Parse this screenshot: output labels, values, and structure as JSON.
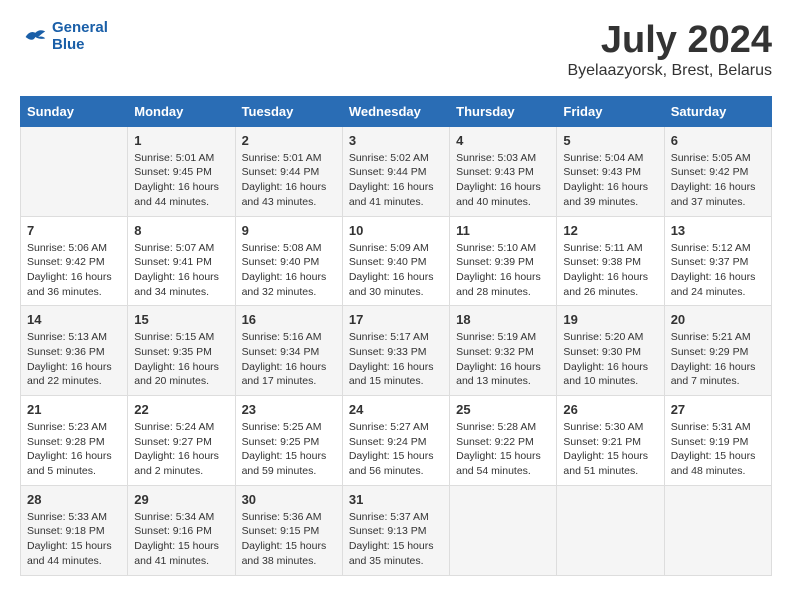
{
  "header": {
    "logo_line1": "General",
    "logo_line2": "Blue",
    "month_title": "July 2024",
    "location": "Byelaazyorsk, Brest, Belarus"
  },
  "weekdays": [
    "Sunday",
    "Monday",
    "Tuesday",
    "Wednesday",
    "Thursday",
    "Friday",
    "Saturday"
  ],
  "weeks": [
    [
      {
        "day": "",
        "info": ""
      },
      {
        "day": "1",
        "info": "Sunrise: 5:01 AM\nSunset: 9:45 PM\nDaylight: 16 hours\nand 44 minutes."
      },
      {
        "day": "2",
        "info": "Sunrise: 5:01 AM\nSunset: 9:44 PM\nDaylight: 16 hours\nand 43 minutes."
      },
      {
        "day": "3",
        "info": "Sunrise: 5:02 AM\nSunset: 9:44 PM\nDaylight: 16 hours\nand 41 minutes."
      },
      {
        "day": "4",
        "info": "Sunrise: 5:03 AM\nSunset: 9:43 PM\nDaylight: 16 hours\nand 40 minutes."
      },
      {
        "day": "5",
        "info": "Sunrise: 5:04 AM\nSunset: 9:43 PM\nDaylight: 16 hours\nand 39 minutes."
      },
      {
        "day": "6",
        "info": "Sunrise: 5:05 AM\nSunset: 9:42 PM\nDaylight: 16 hours\nand 37 minutes."
      }
    ],
    [
      {
        "day": "7",
        "info": "Sunrise: 5:06 AM\nSunset: 9:42 PM\nDaylight: 16 hours\nand 36 minutes."
      },
      {
        "day": "8",
        "info": "Sunrise: 5:07 AM\nSunset: 9:41 PM\nDaylight: 16 hours\nand 34 minutes."
      },
      {
        "day": "9",
        "info": "Sunrise: 5:08 AM\nSunset: 9:40 PM\nDaylight: 16 hours\nand 32 minutes."
      },
      {
        "day": "10",
        "info": "Sunrise: 5:09 AM\nSunset: 9:40 PM\nDaylight: 16 hours\nand 30 minutes."
      },
      {
        "day": "11",
        "info": "Sunrise: 5:10 AM\nSunset: 9:39 PM\nDaylight: 16 hours\nand 28 minutes."
      },
      {
        "day": "12",
        "info": "Sunrise: 5:11 AM\nSunset: 9:38 PM\nDaylight: 16 hours\nand 26 minutes."
      },
      {
        "day": "13",
        "info": "Sunrise: 5:12 AM\nSunset: 9:37 PM\nDaylight: 16 hours\nand 24 minutes."
      }
    ],
    [
      {
        "day": "14",
        "info": "Sunrise: 5:13 AM\nSunset: 9:36 PM\nDaylight: 16 hours\nand 22 minutes."
      },
      {
        "day": "15",
        "info": "Sunrise: 5:15 AM\nSunset: 9:35 PM\nDaylight: 16 hours\nand 20 minutes."
      },
      {
        "day": "16",
        "info": "Sunrise: 5:16 AM\nSunset: 9:34 PM\nDaylight: 16 hours\nand 17 minutes."
      },
      {
        "day": "17",
        "info": "Sunrise: 5:17 AM\nSunset: 9:33 PM\nDaylight: 16 hours\nand 15 minutes."
      },
      {
        "day": "18",
        "info": "Sunrise: 5:19 AM\nSunset: 9:32 PM\nDaylight: 16 hours\nand 13 minutes."
      },
      {
        "day": "19",
        "info": "Sunrise: 5:20 AM\nSunset: 9:30 PM\nDaylight: 16 hours\nand 10 minutes."
      },
      {
        "day": "20",
        "info": "Sunrise: 5:21 AM\nSunset: 9:29 PM\nDaylight: 16 hours\nand 7 minutes."
      }
    ],
    [
      {
        "day": "21",
        "info": "Sunrise: 5:23 AM\nSunset: 9:28 PM\nDaylight: 16 hours\nand 5 minutes."
      },
      {
        "day": "22",
        "info": "Sunrise: 5:24 AM\nSunset: 9:27 PM\nDaylight: 16 hours\nand 2 minutes."
      },
      {
        "day": "23",
        "info": "Sunrise: 5:25 AM\nSunset: 9:25 PM\nDaylight: 15 hours\nand 59 minutes."
      },
      {
        "day": "24",
        "info": "Sunrise: 5:27 AM\nSunset: 9:24 PM\nDaylight: 15 hours\nand 56 minutes."
      },
      {
        "day": "25",
        "info": "Sunrise: 5:28 AM\nSunset: 9:22 PM\nDaylight: 15 hours\nand 54 minutes."
      },
      {
        "day": "26",
        "info": "Sunrise: 5:30 AM\nSunset: 9:21 PM\nDaylight: 15 hours\nand 51 minutes."
      },
      {
        "day": "27",
        "info": "Sunrise: 5:31 AM\nSunset: 9:19 PM\nDaylight: 15 hours\nand 48 minutes."
      }
    ],
    [
      {
        "day": "28",
        "info": "Sunrise: 5:33 AM\nSunset: 9:18 PM\nDaylight: 15 hours\nand 44 minutes."
      },
      {
        "day": "29",
        "info": "Sunrise: 5:34 AM\nSunset: 9:16 PM\nDaylight: 15 hours\nand 41 minutes."
      },
      {
        "day": "30",
        "info": "Sunrise: 5:36 AM\nSunset: 9:15 PM\nDaylight: 15 hours\nand 38 minutes."
      },
      {
        "day": "31",
        "info": "Sunrise: 5:37 AM\nSunset: 9:13 PM\nDaylight: 15 hours\nand 35 minutes."
      },
      {
        "day": "",
        "info": ""
      },
      {
        "day": "",
        "info": ""
      },
      {
        "day": "",
        "info": ""
      }
    ]
  ]
}
